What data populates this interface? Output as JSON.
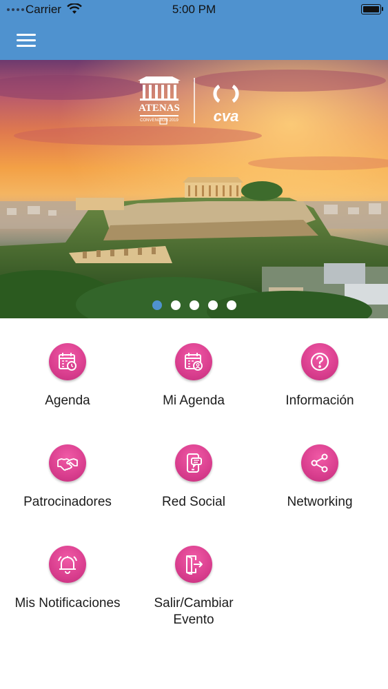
{
  "status_bar": {
    "carrier": "Carrier",
    "time": "5:00 PM"
  },
  "hero": {
    "logo_text": "ATENAS",
    "logo_sub": "CONVENCION 2019",
    "brand": "cva",
    "slides_total": 5,
    "active_slide": 1
  },
  "menu": {
    "items": [
      {
        "label": "Agenda",
        "icon": "calendar-clock-icon"
      },
      {
        "label": "Mi Agenda",
        "icon": "calendar-user-icon"
      },
      {
        "label": "Información",
        "icon": "question-circle-icon"
      },
      {
        "label": "Patrocinadores",
        "icon": "handshake-icon"
      },
      {
        "label": "Red Social",
        "icon": "phone-chat-icon"
      },
      {
        "label": "Networking",
        "icon": "share-nodes-icon"
      },
      {
        "label": "Mis Notificaciones",
        "icon": "bell-icon"
      },
      {
        "label": "Salir/Cambiar Evento",
        "icon": "exit-door-icon"
      }
    ]
  },
  "colors": {
    "nav_bar": "#4f92cf",
    "icon_circle": "#d93e8e",
    "active_dot": "#4f92cf"
  }
}
